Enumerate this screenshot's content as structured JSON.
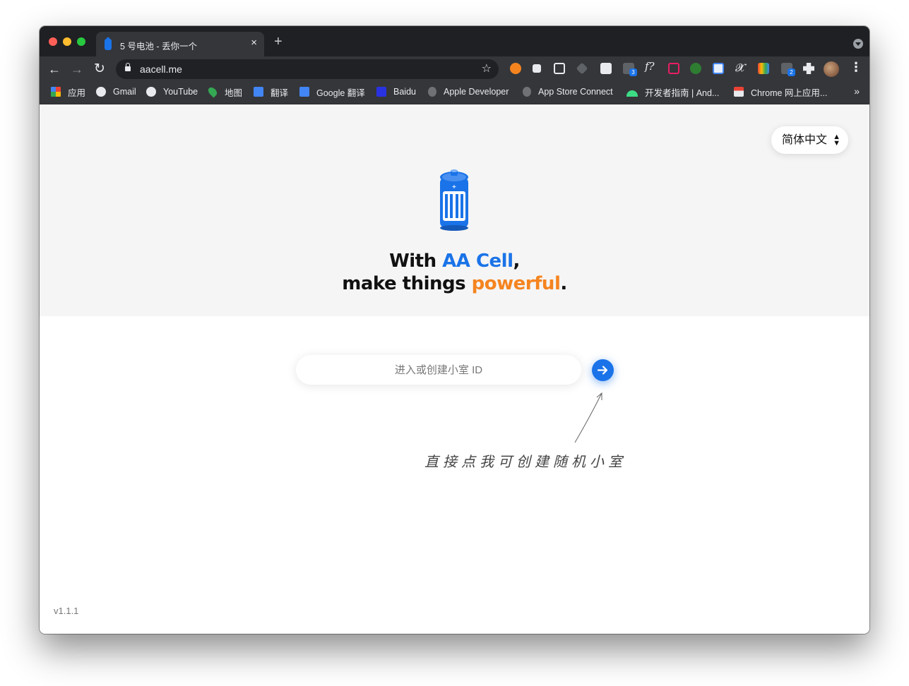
{
  "tab": {
    "title": "5 号电池 - 丢你一个",
    "close": "×",
    "new_tab": "+"
  },
  "toolbar": {
    "back": "←",
    "forward": "→",
    "reload": "↻",
    "url": "aacell.me",
    "bookmark_star": "☆",
    "menu": "⋮"
  },
  "extensions": {
    "badges": [
      "3",
      "2"
    ],
    "formula_label": "f?"
  },
  "bookmarks": {
    "items": [
      {
        "label": "应用",
        "icon": "apps-grid-icon",
        "color": "#ea4335"
      },
      {
        "label": "Gmail",
        "icon": "globe-icon",
        "color": "#e8eaed"
      },
      {
        "label": "YouTube",
        "icon": "globe-icon",
        "color": "#e8eaed"
      },
      {
        "label": "地图",
        "icon": "maps-pin-icon",
        "color": "#34a853"
      },
      {
        "label": "翻译",
        "icon": "translate-icon",
        "color": "#4285f4"
      },
      {
        "label": "Google 翻译",
        "icon": "translate-icon",
        "color": "#4285f4"
      },
      {
        "label": "Baidu",
        "icon": "baidu-paw-icon",
        "color": "#2932e1"
      },
      {
        "label": "Apple Developer",
        "icon": "apple-icon",
        "color": "#9aa0a6"
      },
      {
        "label": "App Store Connect",
        "icon": "apple-icon",
        "color": "#9aa0a6"
      },
      {
        "label": "开发者指南 | And...",
        "icon": "android-icon",
        "color": "#3ddc84"
      },
      {
        "label": "Chrome 网上应用...",
        "icon": "chrome-store-icon",
        "color": "#ea4335"
      }
    ],
    "overflow": "»"
  },
  "language_select": {
    "value": "简体中文",
    "up": "▲",
    "down": "▼"
  },
  "headline": {
    "line1_prefix": "With ",
    "line1_brand": "AA Cell",
    "line1_suffix": ",",
    "line2_prefix": "make things ",
    "line2_accent": "powerful",
    "line2_suffix": "."
  },
  "room": {
    "placeholder": "进入或创建小室 ID"
  },
  "hint": {
    "text": "直接点我可创建随机小室"
  },
  "version": "v1.1.1",
  "colors": {
    "brand_blue": "#1a73e8",
    "accent_orange": "#f5841f",
    "hero_bg": "#f5f5f5"
  }
}
